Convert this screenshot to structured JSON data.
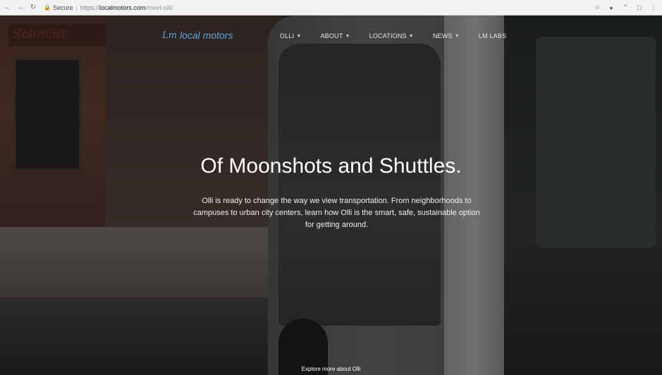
{
  "browser": {
    "nav_icons": [
      "back-icon",
      "forward-icon",
      "reload-icon"
    ],
    "secure_label": "Secure",
    "url_scheme": "https://",
    "url_host": "localmotors.com",
    "url_path": "/meet-olli/",
    "right_icons": [
      "star-icon",
      "extension-icon",
      "extension-icon",
      "extension-icon",
      "menu-icon"
    ]
  },
  "site": {
    "logo_mark": "Lm",
    "logo_text": "local motors",
    "nav": [
      {
        "label": "OLLI",
        "has_caret": true
      },
      {
        "label": "ABOUT",
        "has_caret": true
      },
      {
        "label": "LOCATIONS",
        "has_caret": true
      },
      {
        "label": "NEWS",
        "has_caret": true
      },
      {
        "label": "LM LABS",
        "has_caret": false
      }
    ]
  },
  "hero": {
    "title": "Of Moonshots and Shuttles.",
    "description": "Olli is ready to change the way we view transportation. From neighborhoods to campuses to urban city centers, learn how Olli is the smart, safe, sustainable option for getting around.",
    "explore_label": "Explore more about Olli",
    "background_sign": "Schmidt"
  },
  "colors": {
    "logo": "#5aa7e0",
    "nav_text": "#e6e6e6",
    "hero_text": "#ffffff"
  }
}
